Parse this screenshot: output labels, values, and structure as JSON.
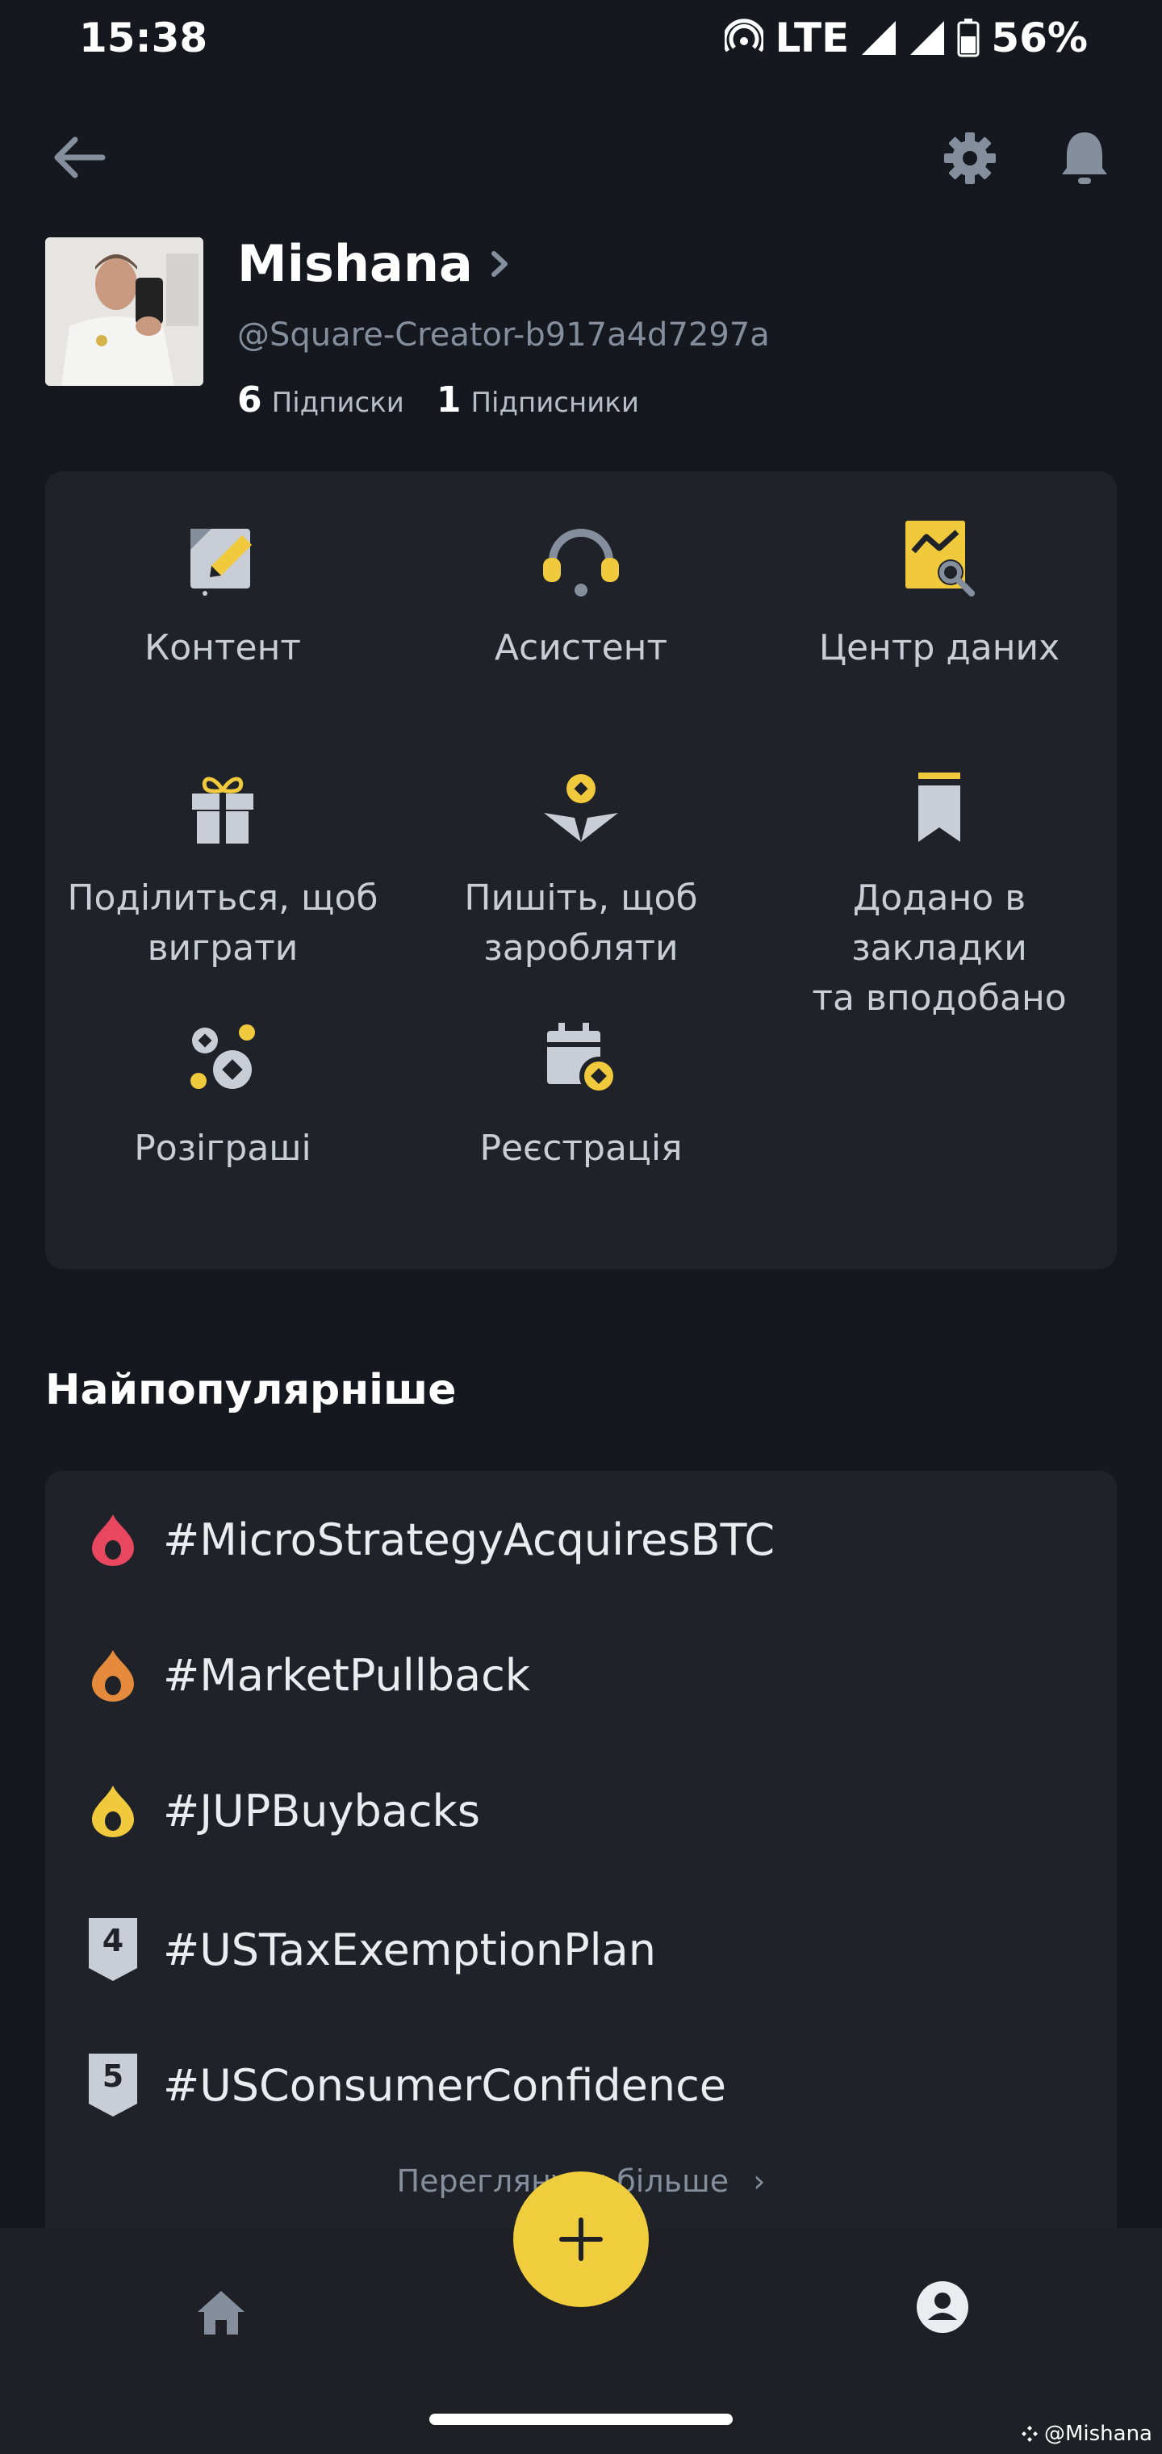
{
  "status": {
    "time": "15:38",
    "network": "LTE",
    "battery": "56%"
  },
  "profile": {
    "name": "Mishana",
    "handle": "@Square-Creator-b917a4d7297a",
    "following_count": "6",
    "following_label": "Підписки",
    "followers_count": "1",
    "followers_label": "Підписники"
  },
  "menu": [
    {
      "label": "Контент",
      "icon": "content-edit-icon"
    },
    {
      "label": "Асистент",
      "icon": "headset-icon"
    },
    {
      "label": "Центр даних",
      "icon": "data-center-icon"
    },
    {
      "label": "Поділиться, щоб\nвиграти",
      "icon": "gift-icon"
    },
    {
      "label": "Пишіть, щоб\nзаробляти",
      "icon": "write-earn-icon"
    },
    {
      "label": "Додано в закладки\nта вподобано",
      "icon": "bookmark-icon"
    },
    {
      "label": "Розіграші",
      "icon": "giveaway-coins-icon"
    },
    {
      "label": "Реєстрація",
      "icon": "calendar-checkin-icon"
    }
  ],
  "popular": {
    "title": "Найпопулярніше",
    "items": [
      {
        "rank": "1",
        "tag": "#MicroStrategyAcquiresBTC"
      },
      {
        "rank": "2",
        "tag": "#MarketPullback"
      },
      {
        "rank": "3",
        "tag": "#JUPBuybacks"
      },
      {
        "rank": "4",
        "tag": "#USTaxExemptionPlan"
      },
      {
        "rank": "5",
        "tag": "#USConsumerConfidence"
      }
    ],
    "more_label": "Переглянути більше"
  },
  "watermark": "@Mishana",
  "colors": {
    "accent": "#f0cd3c",
    "background": "#15181f",
    "card": "#1f2229",
    "fire1": "#e8475f",
    "fire2": "#e58a3c",
    "fire3": "#f0c93c"
  }
}
